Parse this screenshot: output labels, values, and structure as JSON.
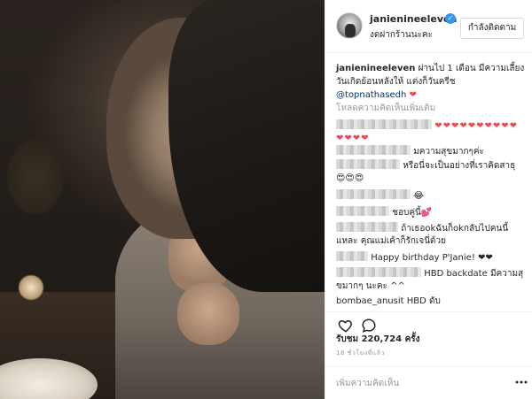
{
  "post": {
    "username": "janienineeleven",
    "location": "งดฝากร้านนะคะ",
    "follow_label": "กำลังติดตาม",
    "verified_mark": "✓"
  },
  "caption": {
    "username": "janienineeleven",
    "text": "ผ่านไป 1 เดือน มีความเลี้ยงวันเกิดย้อนหลังให้ แต่งก็วันครีช",
    "mention": "@topnathasedh",
    "heart": "❤"
  },
  "comments": {
    "load_more": "โหลดความคิดเห็นเพิ่มเติม",
    "items": [
      {
        "text": "❤❤❤❤❤❤❤❤❤❤❤❤❤❤",
        "hearts": true
      },
      {
        "text": "มความสุขมากๆค่ะ"
      },
      {
        "text": "หรือนี่จะเป็นอย่างที่เราคิดสาธุ 😍😍😍"
      },
      {
        "text": "😂"
      },
      {
        "text": "ชอบคู่นี้💕"
      },
      {
        "text": "ถ้าเธอokฉันก็okกลับไปคนนี้แหละ คุณแม่เค้าก็รักเจนี่ด้วย"
      },
      {
        "text": "Happy birthday P'Janie! ❤❤"
      },
      {
        "text": "HBD backdate มีความสุขมากๆ นะคะ ^^"
      },
      {
        "text": "bombae_anusit HBD ดับ"
      }
    ]
  },
  "stats": {
    "views": "รับชม 220,724 ครั้ง",
    "time": "18 ชั่วโมงที่แล้ว"
  },
  "add_comment": {
    "placeholder": "เพิ่มความคิดเห็น"
  },
  "colors": {
    "verified": "#3897f0",
    "heart": "#ed4956",
    "mention": "#003569"
  }
}
